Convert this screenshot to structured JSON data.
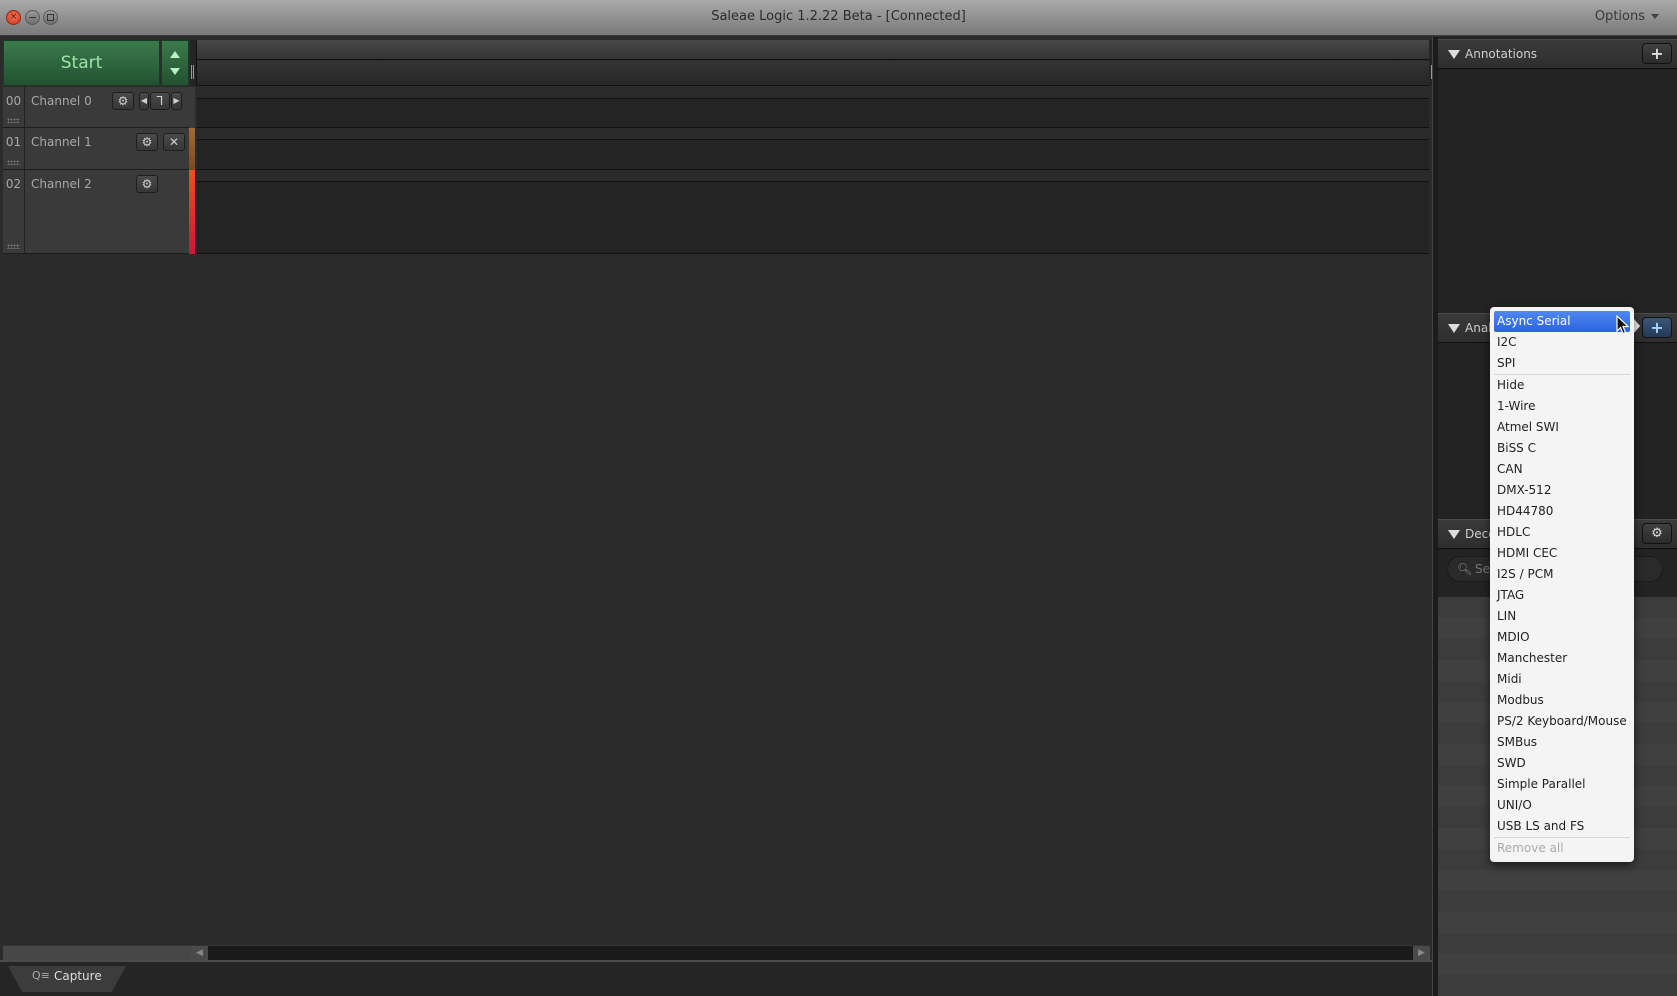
{
  "window": {
    "title": "Saleae Logic 1.2.22 Beta - [Connected]",
    "options_label": "Options"
  },
  "capture": {
    "start_label": "Start"
  },
  "channels": [
    {
      "number": "00",
      "name": "Channel 0",
      "color": "#3a3a3a"
    },
    {
      "number": "01",
      "name": "Channel 1",
      "color": "#8a5a2a"
    },
    {
      "number": "02",
      "name": "Channel 2",
      "color": "#e0402a"
    }
  ],
  "right_panel": {
    "annotations": {
      "title": "Annotations"
    },
    "analyzers": {
      "title": "Analyzers"
    },
    "decoded": {
      "title": "Decoded Protocols",
      "search_placeholder": "Search Protocols"
    }
  },
  "analyzer_menu": {
    "items_top": [
      "Async Serial",
      "I2C",
      "SPI"
    ],
    "selected": "Async Serial",
    "items_more": [
      "Hide",
      "1-Wire",
      "Atmel SWI",
      "BiSS C",
      "CAN",
      "DMX-512",
      "HD44780",
      "HDLC",
      "HDMI CEC",
      "I2S / PCM",
      "JTAG",
      "LIN",
      "MDIO",
      "Manchester",
      "Midi",
      "Modbus",
      "PS/2 Keyboard/Mouse",
      "SMBus",
      "SWD",
      "Simple Parallel",
      "UNI/O",
      "USB LS and FS"
    ],
    "remove_all": "Remove all"
  },
  "bottom_tabs": [
    {
      "label": "Capture"
    }
  ],
  "colors": {
    "start_green": "#2f6a40",
    "selection_blue": "#2a63e1"
  }
}
